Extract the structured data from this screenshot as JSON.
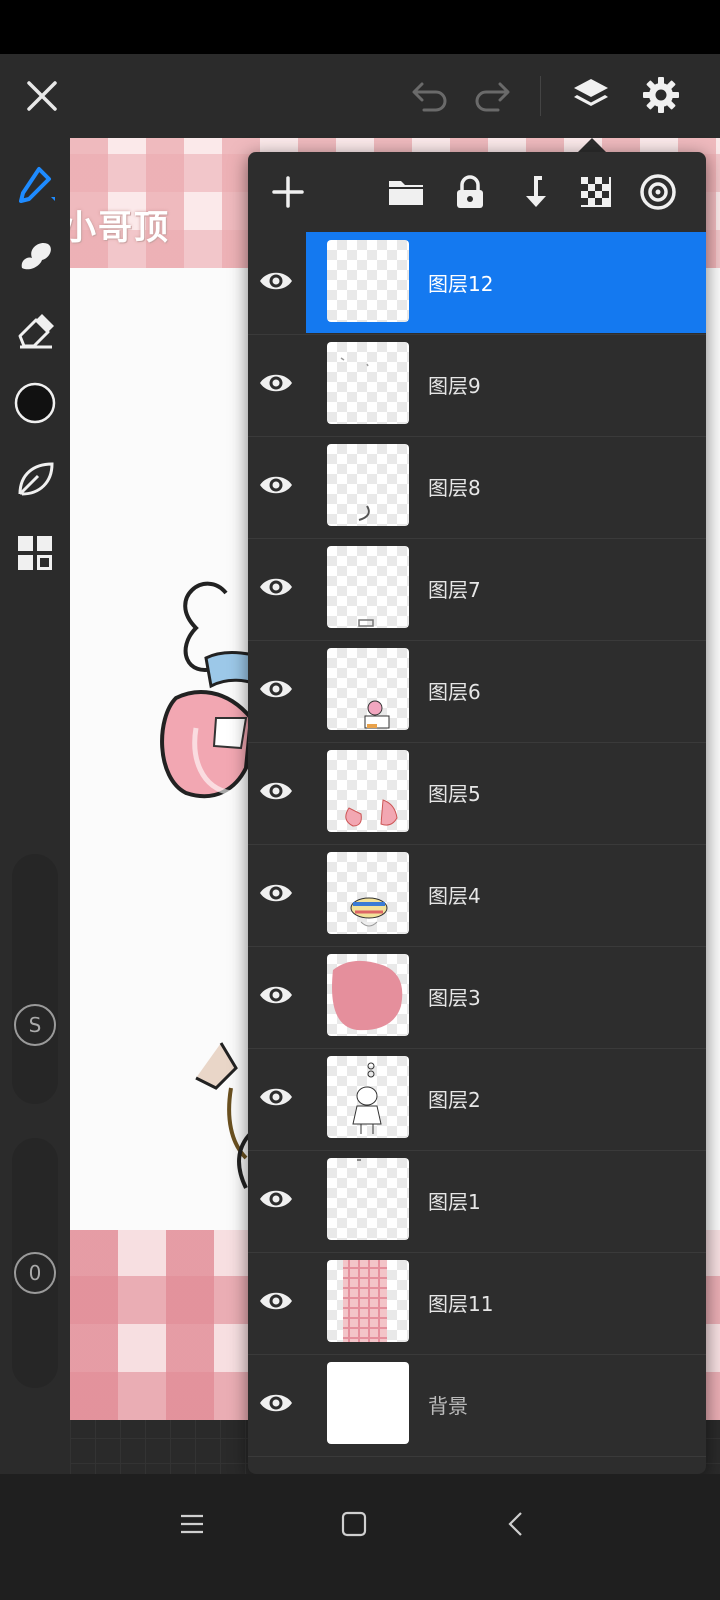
{
  "toolbar": {
    "close": "close-icon",
    "undo": "undo-icon",
    "redo": "redo-icon",
    "layers": "layers-icon",
    "settings": "gear-icon"
  },
  "artwork": {
    "title_text": "小哥顶"
  },
  "sidebar": {
    "tools": [
      "brush-icon",
      "smudge-icon",
      "eraser-icon",
      "color-icon",
      "leaf-icon",
      "grid-icon"
    ],
    "color": "#111111",
    "size_label": "S",
    "opacity_label": "0"
  },
  "layers_panel": {
    "toolbar": [
      "add-icon",
      "folder-icon",
      "lock-icon",
      "merge-down-icon",
      "transparency-icon",
      "radial-icon"
    ],
    "accent": "#1479f0",
    "layers": [
      {
        "name": "图层12",
        "selected": true
      },
      {
        "name": "图层9"
      },
      {
        "name": "图层8"
      },
      {
        "name": "图层7"
      },
      {
        "name": "图层6"
      },
      {
        "name": "图层5"
      },
      {
        "name": "图层4"
      },
      {
        "name": "图层3"
      },
      {
        "name": "图层2"
      },
      {
        "name": "图层1"
      },
      {
        "name": "图层11"
      },
      {
        "name": "背景"
      }
    ]
  },
  "navbar": [
    "menu-icon",
    "home-icon",
    "back-icon"
  ]
}
